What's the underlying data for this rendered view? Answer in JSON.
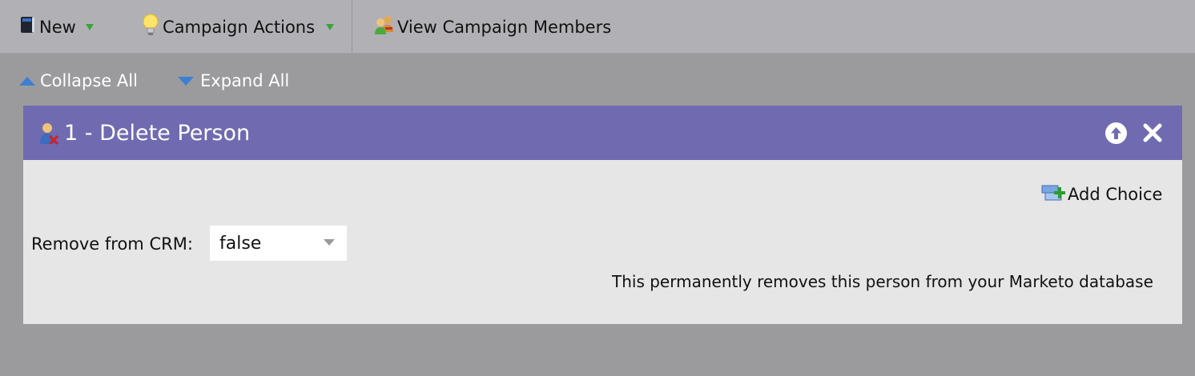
{
  "toolbar": {
    "new_label": "New",
    "campaign_actions_label": "Campaign Actions",
    "view_members_label": "View Campaign Members"
  },
  "subbar": {
    "collapse_label": "Collapse All",
    "expand_label": "Expand All"
  },
  "step": {
    "title": "1 - Delete Person",
    "add_choice_label": "Add Choice",
    "field_label": "Remove from CRM:",
    "field_value": "false",
    "helper_text": "This permanently removes this person from your Marketo database"
  },
  "colors": {
    "toolbar_bg": "#b1b1b5",
    "canvas_bg": "#9b9b9e",
    "card_header": "#706bb0",
    "card_body": "#e6e6e6",
    "accent_blue": "#3d7fd0",
    "caret_green": "#3aa33a"
  },
  "icons": {
    "new": "book-icon",
    "campaign_actions": "lightbulb-icon",
    "view_members": "people-icon",
    "collapse": "triangle-up-icon",
    "expand": "triangle-down-icon",
    "step": "person-delete-icon",
    "move_up": "arrow-up-circle-icon",
    "close": "close-icon",
    "add_choice": "add-choice-icon"
  }
}
